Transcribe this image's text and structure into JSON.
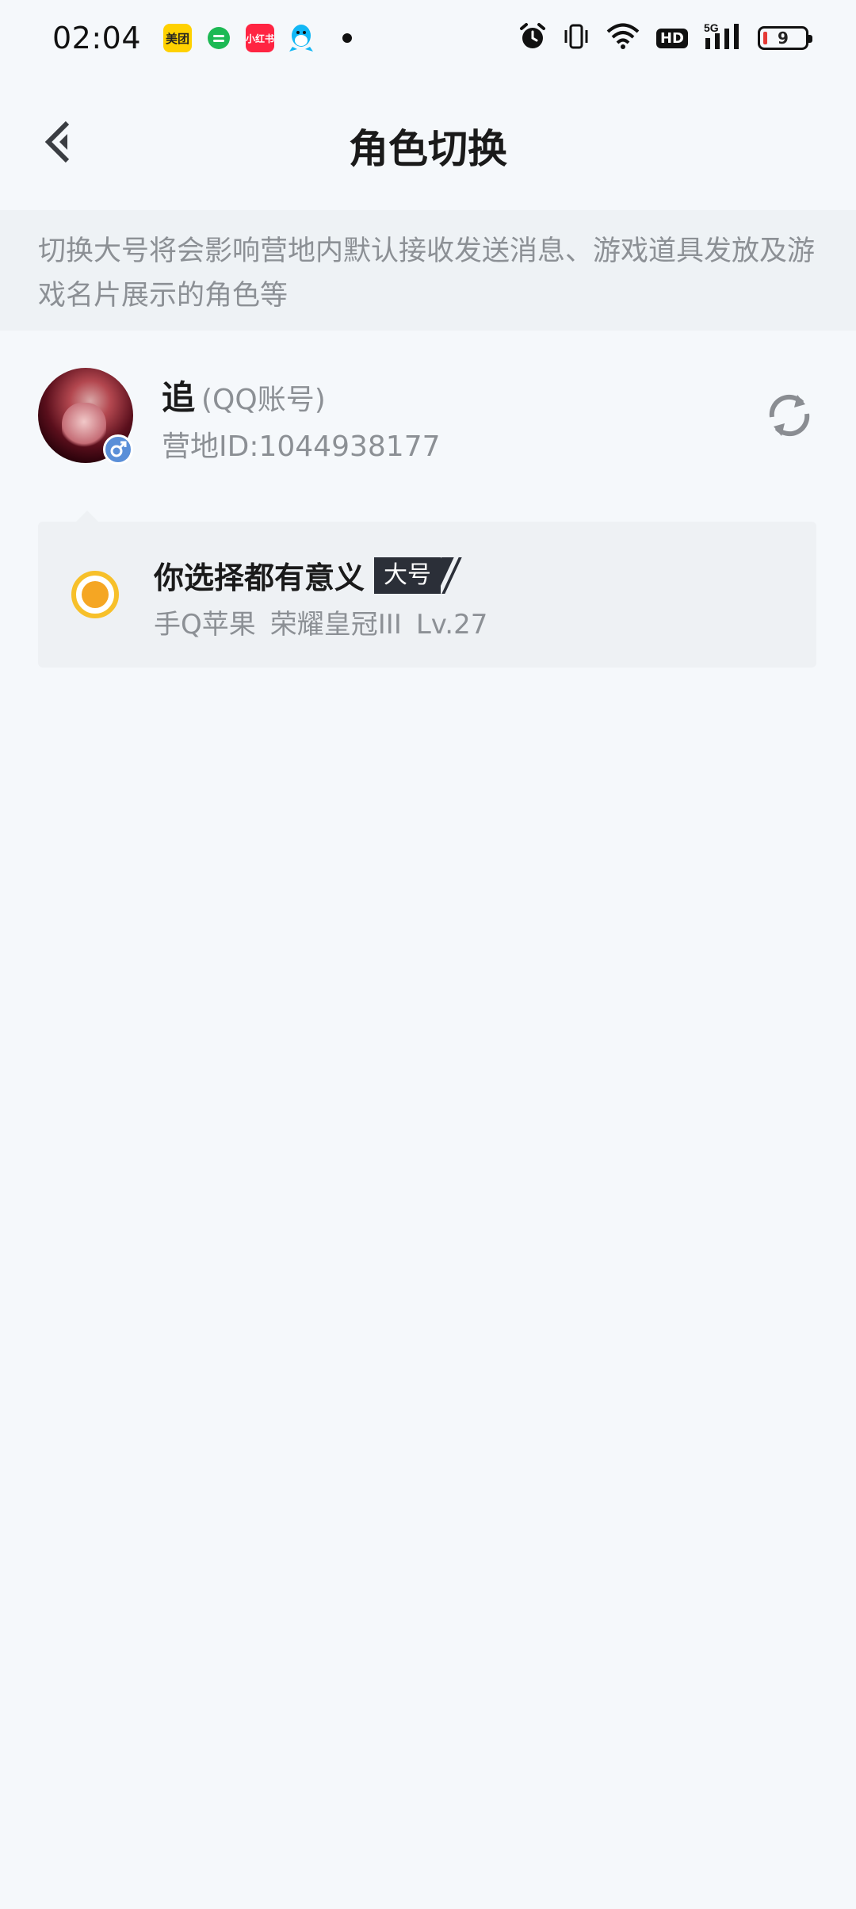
{
  "status_bar": {
    "time": "02:04",
    "app_meituan": "美团",
    "app_xhs": "小红书",
    "battery_level": "9",
    "network": "5G",
    "hd": "HD"
  },
  "header": {
    "title": "角色切换"
  },
  "notice": {
    "text": "切换大号将会影响营地内默认接收发送消息、游戏道具发放及游戏名片展示的角色等"
  },
  "account": {
    "name": "追",
    "type": "(QQ账号)",
    "id": "营地ID:1044938177",
    "gender": "male"
  },
  "role": {
    "name": "你选择都有意义",
    "badge": "大号",
    "platform": "手Q苹果",
    "rank": "荣耀皇冠III",
    "level": "Lv.27",
    "selected": true
  },
  "colors": {
    "background": "#f5f8fb",
    "radio": "#f5a623",
    "gender_badge": "#5a8fd8"
  }
}
